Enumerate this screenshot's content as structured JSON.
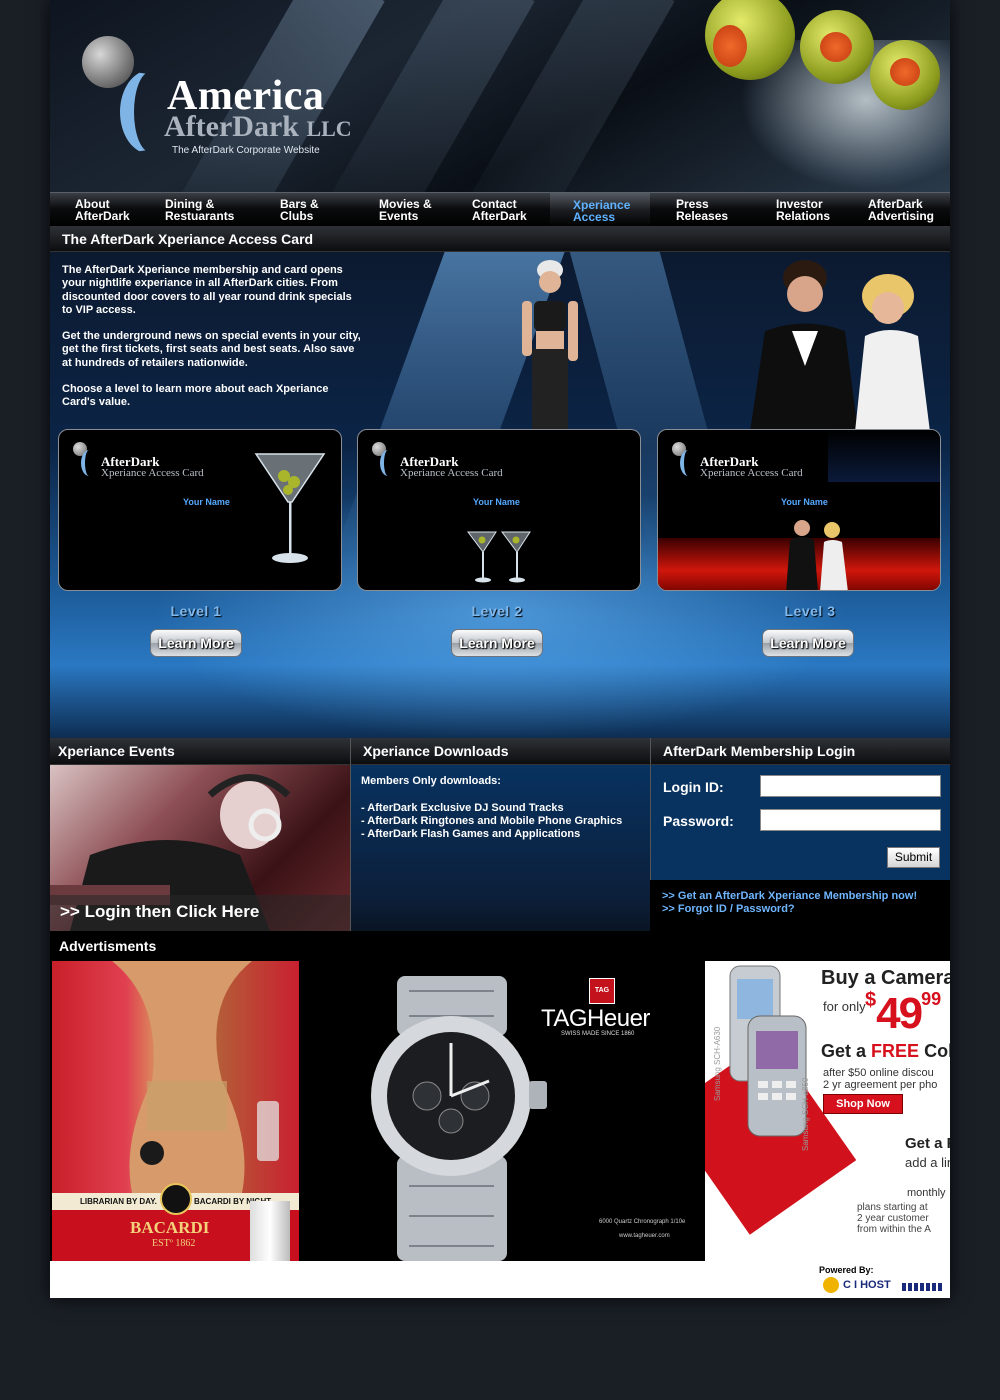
{
  "header": {
    "brand_line1": "America",
    "brand_line2": "AfterDark",
    "brand_suffix": "LLC",
    "tagline": "The AfterDark Corporate Website"
  },
  "nav": [
    {
      "line1": "About",
      "line2": "AfterDark",
      "active": false
    },
    {
      "line1": "Dining &",
      "line2": "Restuarants",
      "active": false
    },
    {
      "line1": "Bars &",
      "line2": "Clubs",
      "active": false
    },
    {
      "line1": "Movies &",
      "line2": "Events",
      "active": false
    },
    {
      "line1": "Contact",
      "line2": "AfterDark",
      "active": false
    },
    {
      "line1": "Xperiance",
      "line2": "Access",
      "active": true
    },
    {
      "line1": "Press",
      "line2": "Releases",
      "active": false
    },
    {
      "line1": "Investor",
      "line2": "Relations",
      "active": false
    },
    {
      "line1": "AfterDark",
      "line2": "Advertising",
      "active": false
    }
  ],
  "section_title": "The AfterDark Xperiance Access Card",
  "intro": [
    "The AfterDark Xperiance membership and card opens your nightlife experiance in all AfterDark cities. From discounted door covers to all year round drink specials to VIP access.",
    "Get the underground news on special events in your city, get the first tickets, first seats and best seats. Also save at hundreds of retailers nationwide.",
    "Choose a level to learn more about each Xperiance Card's value."
  ],
  "cards": [
    {
      "brand": "AfterDark",
      "subtitle": "Xperiance Access Card",
      "name": "Your Name",
      "level": "Level 1",
      "button": "Learn More"
    },
    {
      "brand": "AfterDark",
      "subtitle": "Xperiance Access Card",
      "name": "Your Name",
      "level": "Level 2",
      "button": "Learn More"
    },
    {
      "brand": "AfterDark",
      "subtitle": "Xperiance Access Card",
      "name": "Your Name",
      "level": "Level 3",
      "button": "Learn More"
    }
  ],
  "events": {
    "title": "Xperiance Events",
    "link": ">> Login then Click Here"
  },
  "downloads": {
    "title": "Xperiance Downloads",
    "heading": "Members Only downloads:",
    "items": [
      "- AfterDark Exclusive DJ Sound Tracks",
      "- AfterDark Ringtones and Mobile Phone Graphics",
      "- AfterDark Flash Games and Applications"
    ]
  },
  "login": {
    "title": "AfterDark Membership Login",
    "id_label": "Login ID:",
    "password_label": "Password:",
    "id_value": "",
    "password_value": "",
    "submit": "Submit",
    "links": [
      ">> Get an AfterDark Xperiance Membership now!",
      ">> Forgot ID / Password?"
    ]
  },
  "ads": {
    "title": "Advertisments",
    "bacardi": {
      "slogan_left": "LIBRARIAN BY DAY.",
      "slogan_right": "BACARDI BY NIGHT.",
      "brand": "BACARDI",
      "est": "ESTº 1862"
    },
    "tagheuer": {
      "logo_mark": "TAG",
      "brand": "TAGHeuer",
      "sub": "SWISS MADE SINCE 1860",
      "model": "6000 Quartz Chronograph 1/10e",
      "url": "www.tagheuer.com"
    },
    "samsung": {
      "headline": "Buy a Camera",
      "for_only": "for only",
      "price_dollar": "$",
      "price_main": "49",
      "price_cents": "99",
      "free_line_a": "Get a",
      "free_line_free": "FREE",
      "free_line_b": "Color",
      "rebate_1": "after $50 online discou",
      "rebate_2": "2 yr agreement per pho",
      "shop": "Shop Now",
      "getfa": "Get a Fa",
      "addline": "add a lin",
      "monthly": "monthly",
      "plans_1": "plans starting at",
      "plans_2": "2 year customer",
      "plans_3": "from within the A",
      "model1": "Samsung SCH-A630",
      "model2": "Samsung SCH-a850"
    }
  },
  "footer": {
    "powered": "Powered By:",
    "host": "C I HOST"
  },
  "colors": {
    "accent": "#5fb2ff",
    "panel_blue": "#08325f",
    "price_red": "#d6101c"
  }
}
